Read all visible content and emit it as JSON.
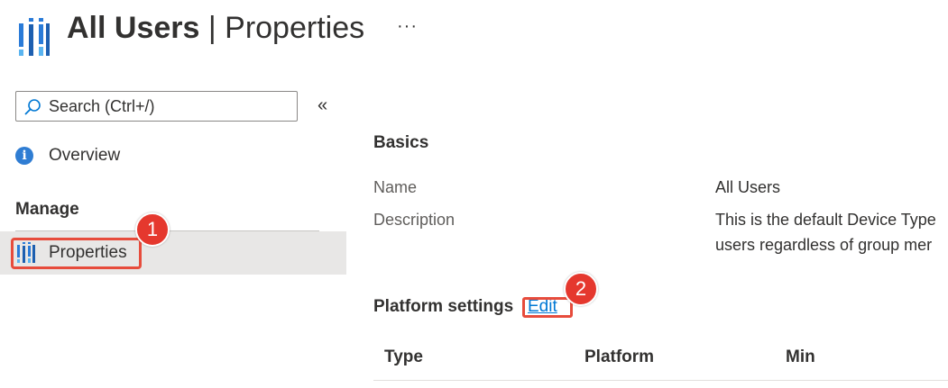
{
  "header": {
    "title_bold": "All Users",
    "title_separator": " | ",
    "title_rest": "Properties",
    "more_label": "···",
    "logo_icon": "intune-bars-icon"
  },
  "sidebar": {
    "search": {
      "placeholder": "Search (Ctrl+/)",
      "value": ""
    },
    "collapse_label": "«",
    "overview": {
      "label": "Overview",
      "icon": "info-icon"
    },
    "manage_heading": "Manage",
    "items": [
      {
        "label": "Properties",
        "icon": "properties-bars-icon",
        "selected": true
      }
    ]
  },
  "annotations": {
    "badge1": "1",
    "badge2": "2",
    "color": "#e5382e"
  },
  "main": {
    "basics_title": "Basics",
    "properties": {
      "name_label": "Name",
      "name_value": "All Users",
      "description_label": "Description",
      "description_line1": "This is the default Device Type",
      "description_line2": "users regardless of group mer"
    },
    "platform_settings": {
      "title": "Platform settings",
      "edit_label": "Edit",
      "columns": [
        "Type",
        "Platform",
        "Min"
      ]
    }
  },
  "colors": {
    "accent": "#0078d4",
    "selected_bg": "#e8e7e6",
    "callout": "#e74c3c"
  }
}
